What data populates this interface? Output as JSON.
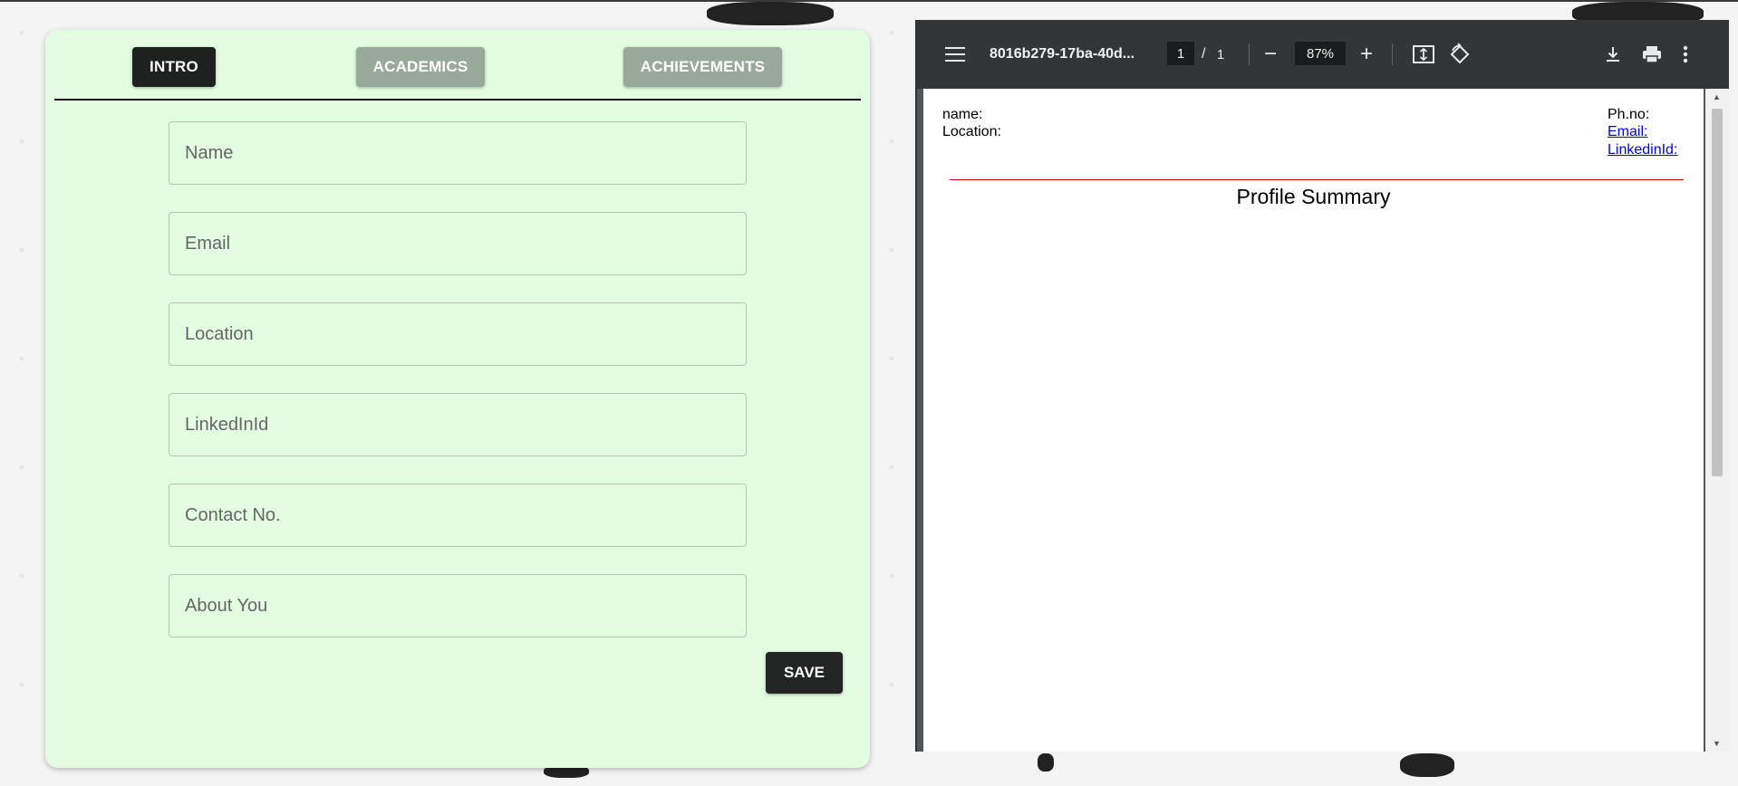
{
  "form": {
    "tabs": [
      {
        "label": "INTRO",
        "active": true
      },
      {
        "label": "ACADEMICS",
        "active": false
      },
      {
        "label": "ACHIEVEMENTS",
        "active": false
      }
    ],
    "fields": [
      {
        "placeholder": "Name",
        "value": ""
      },
      {
        "placeholder": "Email",
        "value": ""
      },
      {
        "placeholder": "Location",
        "value": ""
      },
      {
        "placeholder": "LinkedInId",
        "value": ""
      },
      {
        "placeholder": "Contact No.",
        "value": ""
      },
      {
        "placeholder": "About You",
        "value": ""
      }
    ],
    "save_label": "SAVE"
  },
  "pdf_viewer": {
    "doc_title": "8016b279-17ba-40d...",
    "page_current": "1",
    "page_separator": "/",
    "page_total": "1",
    "zoom": "87%",
    "icons": [
      "menu-icon",
      "zoom-out-icon",
      "zoom-in-icon",
      "fit-to-page-icon",
      "rotate-icon",
      "download-icon",
      "print-icon",
      "more-options-icon"
    ],
    "document": {
      "name_label": "name:",
      "location_label": "Location:",
      "phone_label": "Ph.no:",
      "email_link": "Email:",
      "linkedin_link": "LinkedinId:",
      "section_title": "Profile Summary"
    }
  },
  "colors": {
    "card_bg": "#e2fde2",
    "tab_active": "#1f2121",
    "tab_inactive": "#9aaa9a",
    "save_button": "#232525",
    "toolbar_bg": "#323639",
    "divider_line": "#dd0000",
    "link": "#0000ee"
  }
}
